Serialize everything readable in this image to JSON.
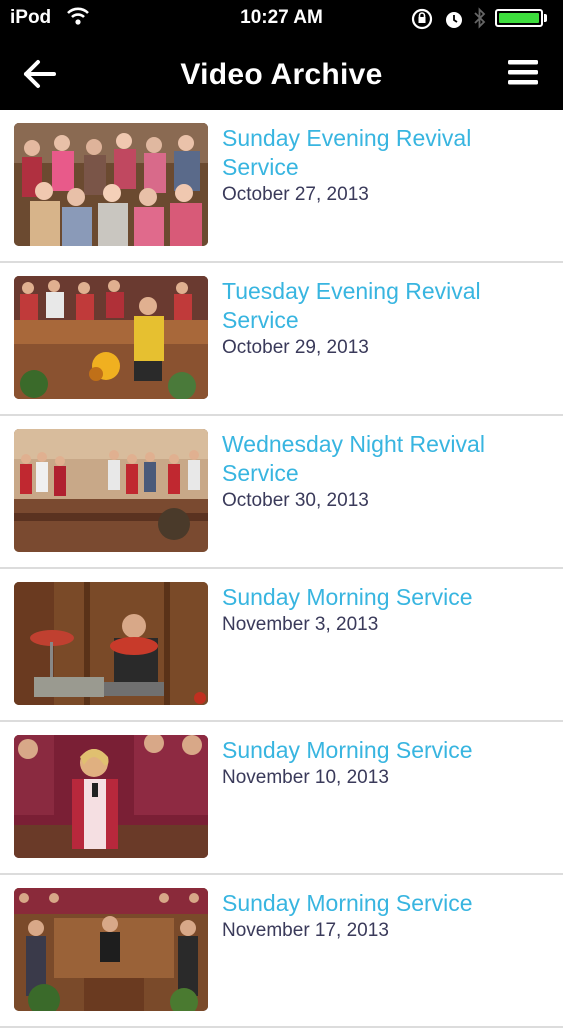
{
  "status": {
    "carrier": "iPod",
    "time": "10:27 AM"
  },
  "nav": {
    "title": "Video Archive",
    "back_icon": "back-arrow-icon",
    "menu_icon": "hamburger-menu-icon"
  },
  "videos": [
    {
      "title": "Sunday Evening Revival Service",
      "date": "October 27, 2013"
    },
    {
      "title": "Tuesday Evening Revival Service",
      "date": "October 29, 2013"
    },
    {
      "title": "Wednesday Night Revival Service",
      "date": "October 30, 2013"
    },
    {
      "title": "Sunday Morning Service",
      "date": "November 3, 2013"
    },
    {
      "title": "Sunday Morning Service",
      "date": "November 10, 2013"
    },
    {
      "title": "Sunday Morning Service",
      "date": "November 17, 2013"
    }
  ],
  "colors": {
    "title_link": "#38b5e0",
    "date_text": "#3a3a5a",
    "bar_background": "#000000",
    "battery": "#3ddc3d"
  }
}
